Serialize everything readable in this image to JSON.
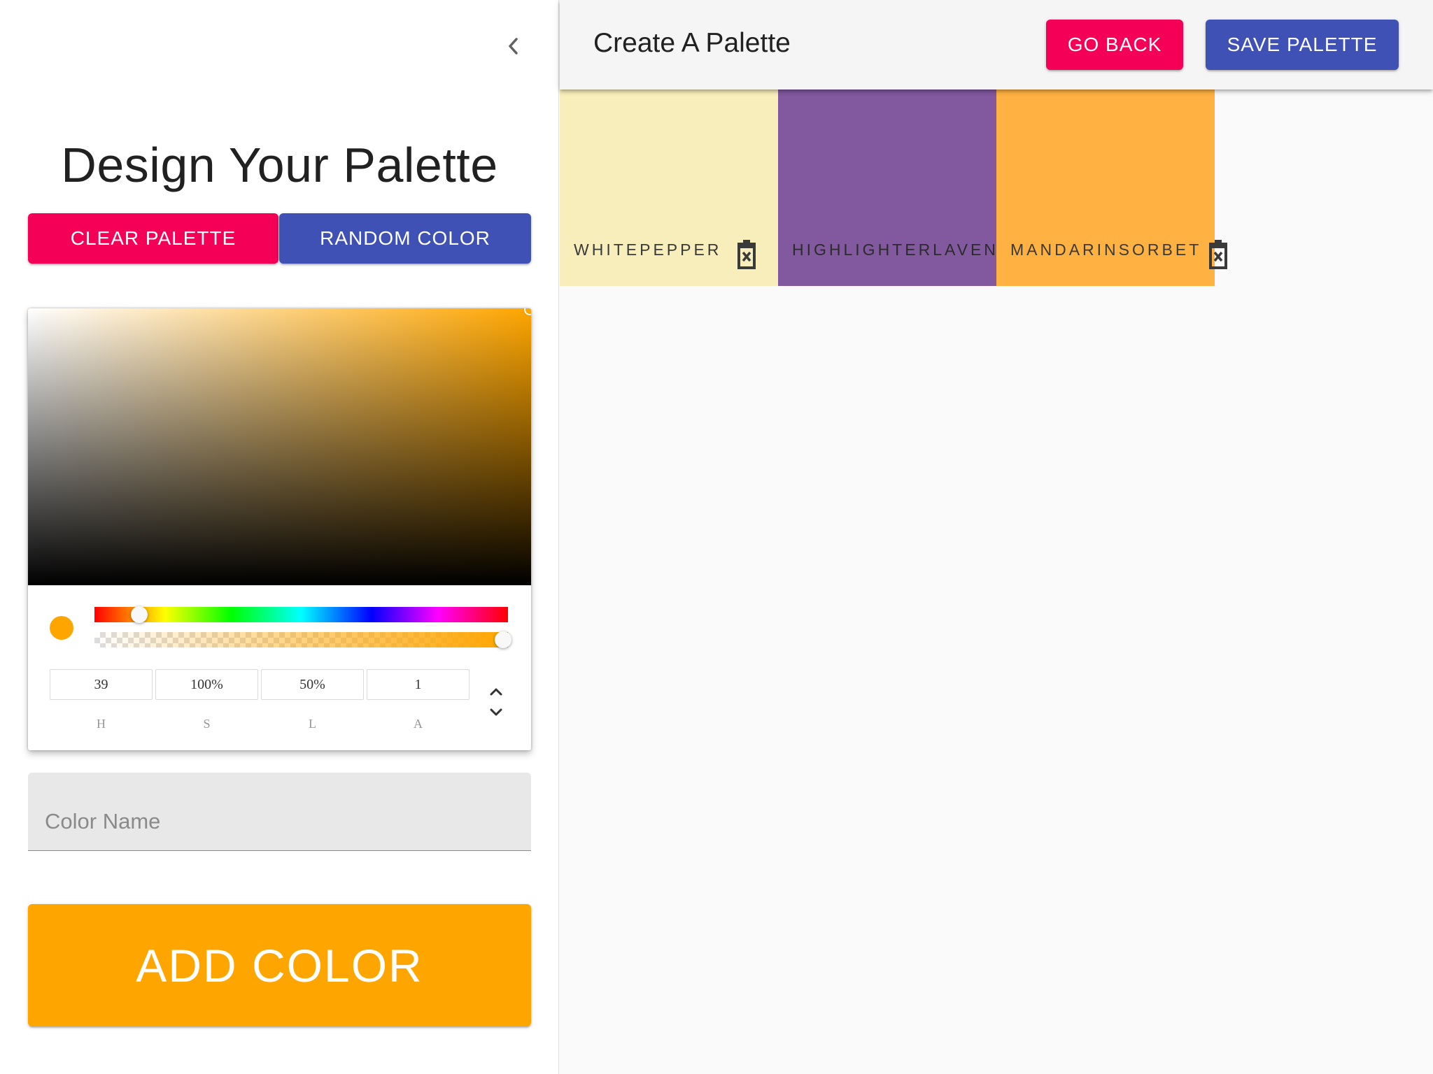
{
  "drawer": {
    "title": "Design Your Palette",
    "clear_label": "Clear Palette",
    "random_label": "Random Color",
    "picker": {
      "fields": [
        {
          "value": "39",
          "label": "h"
        },
        {
          "value": "100%",
          "label": "s"
        },
        {
          "value": "50%",
          "label": "l"
        },
        {
          "value": "1",
          "label": "a"
        }
      ],
      "current_color": "#ffa500",
      "hue_level": 0.108,
      "alpha_level": 1.0
    },
    "color_name": {
      "placeholder": "Color Name",
      "value": ""
    },
    "add_label": "Add Color"
  },
  "appbar": {
    "title": "Create A Palette",
    "goback_label": "Go Back",
    "save_label": "Save Palette"
  },
  "palette": {
    "colors": [
      {
        "name": "whitepepper",
        "color": "#f8eebb",
        "text_color": "#3a3a3a"
      },
      {
        "name": "highlighterlavender",
        "color": "#82589f",
        "text_color": "#2b2b2b"
      },
      {
        "name": "mandarinsorbet",
        "color": "#ffb142",
        "text_color": "#3a3a3a"
      }
    ]
  },
  "colors": {
    "primary": "#3f51b5",
    "secondary": "#f50057",
    "add_button": "#ffa500"
  },
  "icons": {
    "drawer_close": "chevron-left-icon",
    "delete": "trash-icon",
    "toggle": "unfold-more-icon"
  }
}
